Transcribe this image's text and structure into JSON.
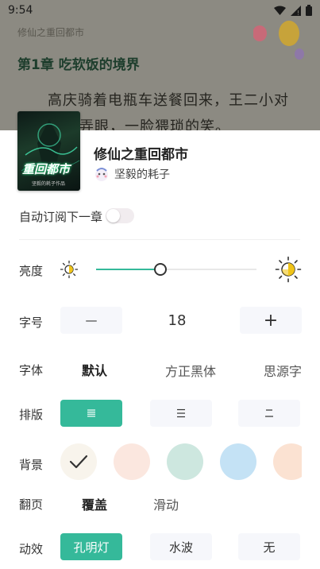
{
  "status": {
    "time": "9:54"
  },
  "reader": {
    "book_subtitle": "修仙之重回都市",
    "chapter_title": "第1章 吃软饭的境界",
    "lines": [
      "高庆骑着电瓶车送餐回来，王二小对",
      "弄眼，一脸猥琐的笑。"
    ]
  },
  "book": {
    "name": "修仙之重回都市",
    "author": "坚毅的耗子",
    "cover_title": "重回都市",
    "cover_sub": "坚毅的耗子作品"
  },
  "settings": {
    "auto_subscribe": {
      "label": "自动订阅下一章",
      "enabled": false
    },
    "brightness": {
      "label": "亮度",
      "level": 0.4
    },
    "font_size": {
      "label": "字号",
      "decrease": "—",
      "value": "18",
      "increase": "+"
    },
    "font_family": {
      "label": "字体",
      "options": [
        "默认",
        "方正黑体",
        "思源字"
      ],
      "selected": "默认"
    },
    "layout": {
      "label": "排版",
      "options": [
        "≡",
        "☰",
        "☱"
      ],
      "selected": 0
    },
    "background": {
      "label": "背景",
      "colors": [
        "#f8f4ec",
        "#fbe7df",
        "#cde7df",
        "#c4e2f5",
        "#fbe2d2"
      ],
      "selected": 0
    },
    "page_turn": {
      "label": "翻页",
      "options": [
        "覆盖",
        "滑动"
      ],
      "selected": "覆盖"
    },
    "animation": {
      "label": "动效",
      "options": [
        "孔明灯",
        "水波",
        "无"
      ],
      "selected": "孔明灯"
    }
  },
  "colors": {
    "accent": "#35b99a"
  }
}
